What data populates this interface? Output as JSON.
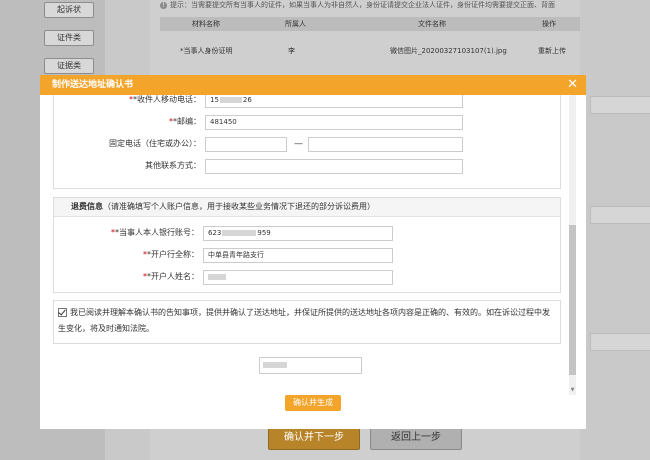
{
  "background": {
    "sidebar": [
      "起诉状",
      "证件类",
      "证据类"
    ],
    "tip": "提示：当需要提交所有当事人的证件，如果当事人为非自然人，身份证请提交企业法人证件，身份证件均需要提交正面、背面",
    "table_headers": [
      "材料名称",
      "所属人",
      "文件名称",
      "操作"
    ],
    "table_row": {
      "name": "*当事人身份证明",
      "owner": "李",
      "file": "微信图片_20200327103107(1).jpg",
      "action": "重新上传"
    },
    "confirm_next": "确认并下一步",
    "back": "返回上一步"
  },
  "modal": {
    "title": "制作送达地址确认书",
    "close": "✕",
    "contact": {
      "mobile_label": "*收件人移动电话：",
      "mobile_value": "15",
      "mobile_value_tail": "26",
      "zip_label": "*邮编：",
      "zip_value": "481450",
      "phone_label": "固定电话（住宅或办公）：",
      "phone_dash": "—",
      "other_label": "其他联系方式："
    },
    "refund": {
      "title": "退费信息",
      "subtitle": "（请准确填写个人账户信息，用于接收某些业务情况下退还的部分诉讼费用）",
      "account_label": "*当事人本人银行账号：",
      "account_value": "623",
      "account_value_tail": "959",
      "bank_label": "*开户行全称：",
      "bank_value": "中单县青年路支行",
      "holder_label": "*开户人姓名："
    },
    "agreement": "我已阅读并理解本确认书的告知事项，提供并确认了送达地址，并保证所提供的送达地址各项内容是正确的、有效的。如在诉讼过程中发生变化，将及时通知法院。",
    "generate_button": "确认并生成"
  }
}
